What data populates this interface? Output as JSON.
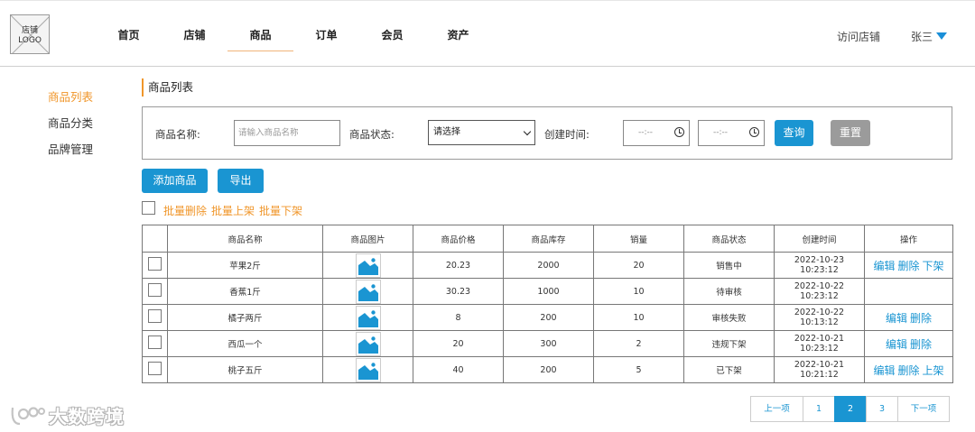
{
  "logo": {
    "line1": "店铺",
    "line2": "LOGO"
  },
  "nav": {
    "items": [
      "首页",
      "店铺",
      "商品",
      "订单",
      "会员",
      "资产"
    ],
    "active_index": 2
  },
  "header": {
    "visit_store": "访问店铺",
    "username": "张三"
  },
  "sidebar": {
    "items": [
      "商品列表",
      "商品分类",
      "品牌管理"
    ],
    "active_index": 0
  },
  "page_title": "商品列表",
  "filter": {
    "name_label": "商品名称:",
    "name_placeholder": "请输入商品名称",
    "status_label": "商品状态:",
    "status_selected": "请选择",
    "time_label": "创建时间:",
    "time_start": "--:--",
    "time_end": "--:--",
    "query_button": "查询",
    "reset_button": "重置"
  },
  "actions": {
    "add_button": "添加商品",
    "export_button": "导出"
  },
  "batch": {
    "delete": "批量删除",
    "on_shelf": "批量上架",
    "off_shelf": "批量下架"
  },
  "table": {
    "headers": [
      "商品名称",
      "商品图片",
      "商品价格",
      "商品库存",
      "销量",
      "商品状态",
      "创建时间",
      "操作"
    ],
    "rows": [
      {
        "name": "苹果2斤",
        "price": "20.23",
        "stock": "2000",
        "sales": "20",
        "status": "销售中",
        "created": "2022-10-23 10:23:12",
        "ops": [
          "编辑",
          "删除",
          "下架"
        ]
      },
      {
        "name": "香蕉1斤",
        "price": "30.23",
        "stock": "1000",
        "sales": "10",
        "status": "待审核",
        "created": "2022-10-22 10:23:12",
        "ops": []
      },
      {
        "name": "橘子两斤",
        "price": "8",
        "stock": "200",
        "sales": "10",
        "status": "审核失败",
        "created": "2022-10-22 10:13:12",
        "ops": [
          "编辑",
          "删除"
        ]
      },
      {
        "name": "西瓜一个",
        "price": "20",
        "stock": "300",
        "sales": "2",
        "status": "违规下架",
        "created": "2022-10-21 10:23:12",
        "ops": [
          "编辑",
          "删除"
        ]
      },
      {
        "name": "桃子五斤",
        "price": "40",
        "stock": "200",
        "sales": "5",
        "status": "已下架",
        "created": "2022-10-21 10:21:12",
        "ops": [
          "编辑",
          "删除",
          "上架"
        ]
      }
    ]
  },
  "pagination": {
    "prev": "上一项",
    "pages": [
      "1",
      "2",
      "3"
    ],
    "current_index": 1,
    "next": "下一项"
  },
  "watermark": "大数跨境",
  "colors": {
    "accent_orange": "#f0962a",
    "primary_blue": "#1a95d2",
    "reset_gray": "#9b9b9b"
  }
}
